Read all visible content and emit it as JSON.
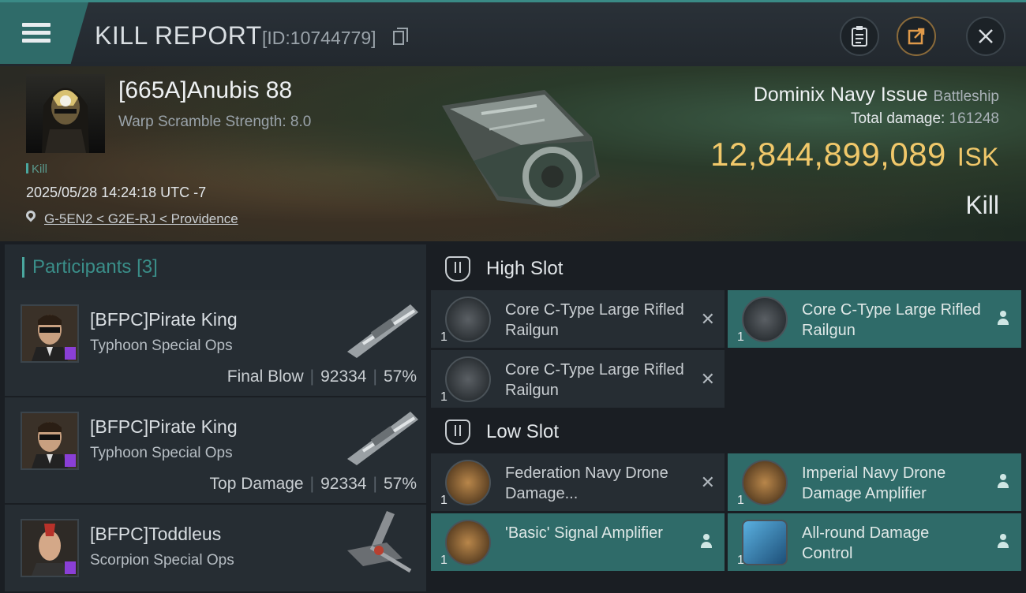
{
  "header": {
    "title": "KILL REPORT",
    "report_id": "[ID:10744779]",
    "icons": {
      "menu": "hamburger-menu-icon",
      "copy": "copy-icon",
      "clipboard": "clipboard-icon",
      "share": "share-export-icon",
      "close": "close-icon"
    }
  },
  "victim": {
    "name": "[665A]Anubis 88",
    "warp_scramble": "Warp Scramble Strength: 8.0",
    "tag": "Kill",
    "datetime": "2025/05/28 14:24:18 UTC -7",
    "location": "G-5EN2 < G2E-RJ < Providence",
    "ship_name": "Dominix Navy Issue",
    "ship_class": "Battleship",
    "total_damage_label": "Total damage:",
    "total_damage": "161248",
    "isk_value": "12,844,899,089",
    "isk_unit": "ISK",
    "result": "Kill"
  },
  "participants": {
    "label": "Participants",
    "count": "[3]",
    "items": [
      {
        "name": "[BFPC]Pirate King",
        "ship": "Typhoon Special Ops",
        "stat_label": "Final Blow",
        "damage": "92334",
        "percent": "57%"
      },
      {
        "name": "[BFPC]Pirate King",
        "ship": "Typhoon Special Ops",
        "stat_label": "Top Damage",
        "damage": "92334",
        "percent": "57%"
      },
      {
        "name": "[BFPC]Toddleus",
        "ship": "Scorpion Special Ops",
        "stat_label": "",
        "damage": "",
        "percent": ""
      }
    ]
  },
  "slots": {
    "high": {
      "label": "High Slot",
      "items": [
        {
          "name": "Core C-Type Large Rifled Railgun",
          "qty": "1",
          "status": "destroyed"
        },
        {
          "name": "Core C-Type Large Rifled Railgun",
          "qty": "1",
          "status": "dropped"
        },
        {
          "name": "Core C-Type Large Rifled Railgun",
          "qty": "1",
          "status": "destroyed"
        }
      ]
    },
    "low": {
      "label": "Low Slot",
      "items": [
        {
          "name": "Federation Navy Drone Damage...",
          "qty": "1",
          "status": "destroyed"
        },
        {
          "name": "Imperial Navy Drone Damage Amplifier",
          "qty": "1",
          "status": "dropped"
        },
        {
          "name": "'Basic' Signal Amplifier",
          "qty": "1",
          "status": "dropped"
        },
        {
          "name": "All-round Damage Control",
          "qty": "1",
          "status": "dropped"
        }
      ]
    }
  },
  "colors": {
    "accent": "#2f6b69",
    "isk": "#f1c86a",
    "participant_header": "#3a8e89"
  }
}
